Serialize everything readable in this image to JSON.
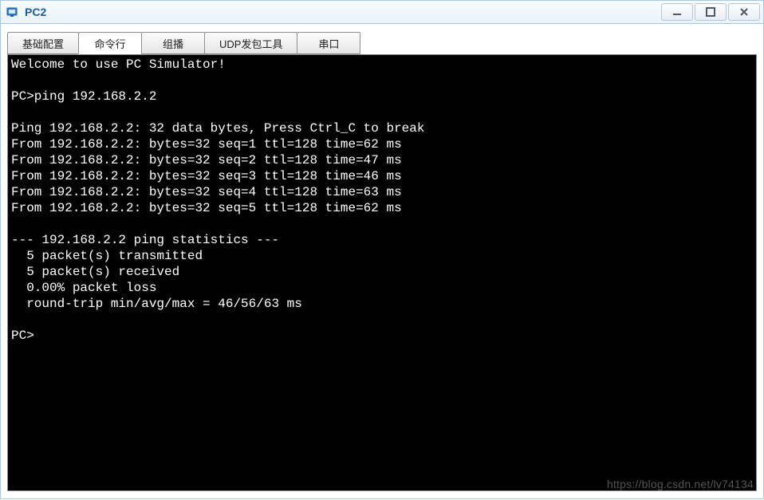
{
  "window": {
    "title": "PC2"
  },
  "tabs": {
    "items": [
      {
        "label": "基础配置"
      },
      {
        "label": "命令行"
      },
      {
        "label": "组播"
      },
      {
        "label": "UDP发包工具"
      },
      {
        "label": "串口"
      }
    ],
    "active_index": 1
  },
  "terminal": {
    "welcome": "Welcome to use PC Simulator!",
    "blank": "",
    "prompt_cmd": "PC>ping 192.168.2.2",
    "ping_header": "Ping 192.168.2.2: 32 data bytes, Press Ctrl_C to break",
    "replies": [
      "From 192.168.2.2: bytes=32 seq=1 ttl=128 time=62 ms",
      "From 192.168.2.2: bytes=32 seq=2 ttl=128 time=47 ms",
      "From 192.168.2.2: bytes=32 seq=3 ttl=128 time=46 ms",
      "From 192.168.2.2: bytes=32 seq=4 ttl=128 time=63 ms",
      "From 192.168.2.2: bytes=32 seq=5 ttl=128 time=62 ms"
    ],
    "stats_header": "--- 192.168.2.2 ping statistics ---",
    "stats_tx": "  5 packet(s) transmitted",
    "stats_rx": "  5 packet(s) received",
    "stats_loss": "  0.00% packet loss",
    "stats_rtt": "  round-trip min/avg/max = 46/56/63 ms",
    "prompt_idle": "PC>"
  },
  "watermark": "https://blog.csdn.net/lv74134"
}
